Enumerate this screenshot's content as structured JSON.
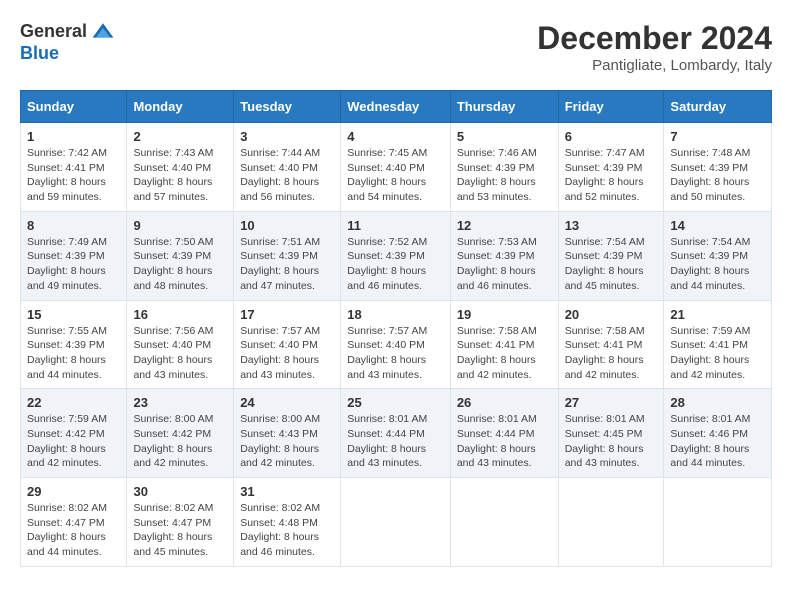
{
  "header": {
    "logo_general": "General",
    "logo_blue": "Blue",
    "month_title": "December 2024",
    "location": "Pantigliate, Lombardy, Italy"
  },
  "days_of_week": [
    "Sunday",
    "Monday",
    "Tuesday",
    "Wednesday",
    "Thursday",
    "Friday",
    "Saturday"
  ],
  "weeks": [
    [
      {
        "day": "1",
        "sunrise": "7:42 AM",
        "sunset": "4:41 PM",
        "daylight": "8 hours and 59 minutes."
      },
      {
        "day": "2",
        "sunrise": "7:43 AM",
        "sunset": "4:40 PM",
        "daylight": "8 hours and 57 minutes."
      },
      {
        "day": "3",
        "sunrise": "7:44 AM",
        "sunset": "4:40 PM",
        "daylight": "8 hours and 56 minutes."
      },
      {
        "day": "4",
        "sunrise": "7:45 AM",
        "sunset": "4:40 PM",
        "daylight": "8 hours and 54 minutes."
      },
      {
        "day": "5",
        "sunrise": "7:46 AM",
        "sunset": "4:39 PM",
        "daylight": "8 hours and 53 minutes."
      },
      {
        "day": "6",
        "sunrise": "7:47 AM",
        "sunset": "4:39 PM",
        "daylight": "8 hours and 52 minutes."
      },
      {
        "day": "7",
        "sunrise": "7:48 AM",
        "sunset": "4:39 PM",
        "daylight": "8 hours and 50 minutes."
      }
    ],
    [
      {
        "day": "8",
        "sunrise": "7:49 AM",
        "sunset": "4:39 PM",
        "daylight": "8 hours and 49 minutes."
      },
      {
        "day": "9",
        "sunrise": "7:50 AM",
        "sunset": "4:39 PM",
        "daylight": "8 hours and 48 minutes."
      },
      {
        "day": "10",
        "sunrise": "7:51 AM",
        "sunset": "4:39 PM",
        "daylight": "8 hours and 47 minutes."
      },
      {
        "day": "11",
        "sunrise": "7:52 AM",
        "sunset": "4:39 PM",
        "daylight": "8 hours and 46 minutes."
      },
      {
        "day": "12",
        "sunrise": "7:53 AM",
        "sunset": "4:39 PM",
        "daylight": "8 hours and 46 minutes."
      },
      {
        "day": "13",
        "sunrise": "7:54 AM",
        "sunset": "4:39 PM",
        "daylight": "8 hours and 45 minutes."
      },
      {
        "day": "14",
        "sunrise": "7:54 AM",
        "sunset": "4:39 PM",
        "daylight": "8 hours and 44 minutes."
      }
    ],
    [
      {
        "day": "15",
        "sunrise": "7:55 AM",
        "sunset": "4:39 PM",
        "daylight": "8 hours and 44 minutes."
      },
      {
        "day": "16",
        "sunrise": "7:56 AM",
        "sunset": "4:40 PM",
        "daylight": "8 hours and 43 minutes."
      },
      {
        "day": "17",
        "sunrise": "7:57 AM",
        "sunset": "4:40 PM",
        "daylight": "8 hours and 43 minutes."
      },
      {
        "day": "18",
        "sunrise": "7:57 AM",
        "sunset": "4:40 PM",
        "daylight": "8 hours and 43 minutes."
      },
      {
        "day": "19",
        "sunrise": "7:58 AM",
        "sunset": "4:41 PM",
        "daylight": "8 hours and 42 minutes."
      },
      {
        "day": "20",
        "sunrise": "7:58 AM",
        "sunset": "4:41 PM",
        "daylight": "8 hours and 42 minutes."
      },
      {
        "day": "21",
        "sunrise": "7:59 AM",
        "sunset": "4:41 PM",
        "daylight": "8 hours and 42 minutes."
      }
    ],
    [
      {
        "day": "22",
        "sunrise": "7:59 AM",
        "sunset": "4:42 PM",
        "daylight": "8 hours and 42 minutes."
      },
      {
        "day": "23",
        "sunrise": "8:00 AM",
        "sunset": "4:42 PM",
        "daylight": "8 hours and 42 minutes."
      },
      {
        "day": "24",
        "sunrise": "8:00 AM",
        "sunset": "4:43 PM",
        "daylight": "8 hours and 42 minutes."
      },
      {
        "day": "25",
        "sunrise": "8:01 AM",
        "sunset": "4:44 PM",
        "daylight": "8 hours and 43 minutes."
      },
      {
        "day": "26",
        "sunrise": "8:01 AM",
        "sunset": "4:44 PM",
        "daylight": "8 hours and 43 minutes."
      },
      {
        "day": "27",
        "sunrise": "8:01 AM",
        "sunset": "4:45 PM",
        "daylight": "8 hours and 43 minutes."
      },
      {
        "day": "28",
        "sunrise": "8:01 AM",
        "sunset": "4:46 PM",
        "daylight": "8 hours and 44 minutes."
      }
    ],
    [
      {
        "day": "29",
        "sunrise": "8:02 AM",
        "sunset": "4:47 PM",
        "daylight": "8 hours and 44 minutes."
      },
      {
        "day": "30",
        "sunrise": "8:02 AM",
        "sunset": "4:47 PM",
        "daylight": "8 hours and 45 minutes."
      },
      {
        "day": "31",
        "sunrise": "8:02 AM",
        "sunset": "4:48 PM",
        "daylight": "8 hours and 46 minutes."
      },
      null,
      null,
      null,
      null
    ]
  ],
  "labels": {
    "sunrise": "Sunrise:",
    "sunset": "Sunset:",
    "daylight": "Daylight:"
  }
}
